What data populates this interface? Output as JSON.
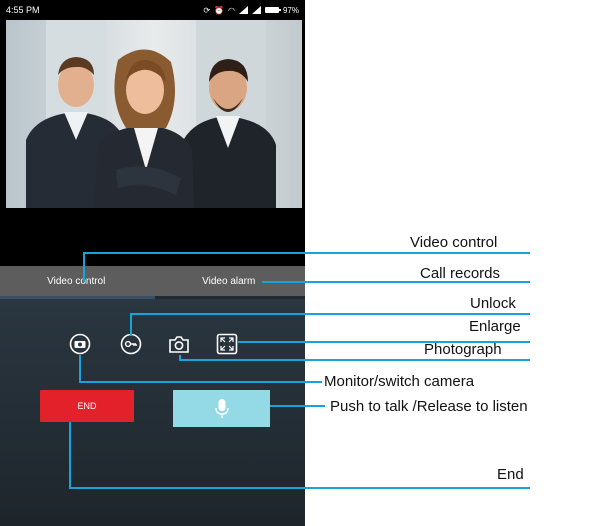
{
  "status_bar": {
    "time": "4:55 PM",
    "battery": "97%"
  },
  "tabs": [
    {
      "label": "Video control"
    },
    {
      "label": "Video alarm"
    }
  ],
  "controls": {
    "end_label": "END"
  },
  "callouts": {
    "video_control": "Video control",
    "call_records": "Call records",
    "unlock": "Unlock",
    "enlarge": "Enlarge",
    "photograph": "Photograph",
    "monitor": "Monitor/switch camera",
    "push_to_talk": "Push to talk /Release to listen",
    "end": "End"
  },
  "colors": {
    "callout_line": "#18a3dc",
    "end_button": "#e2212a",
    "talk_button": "#93d9e6"
  }
}
